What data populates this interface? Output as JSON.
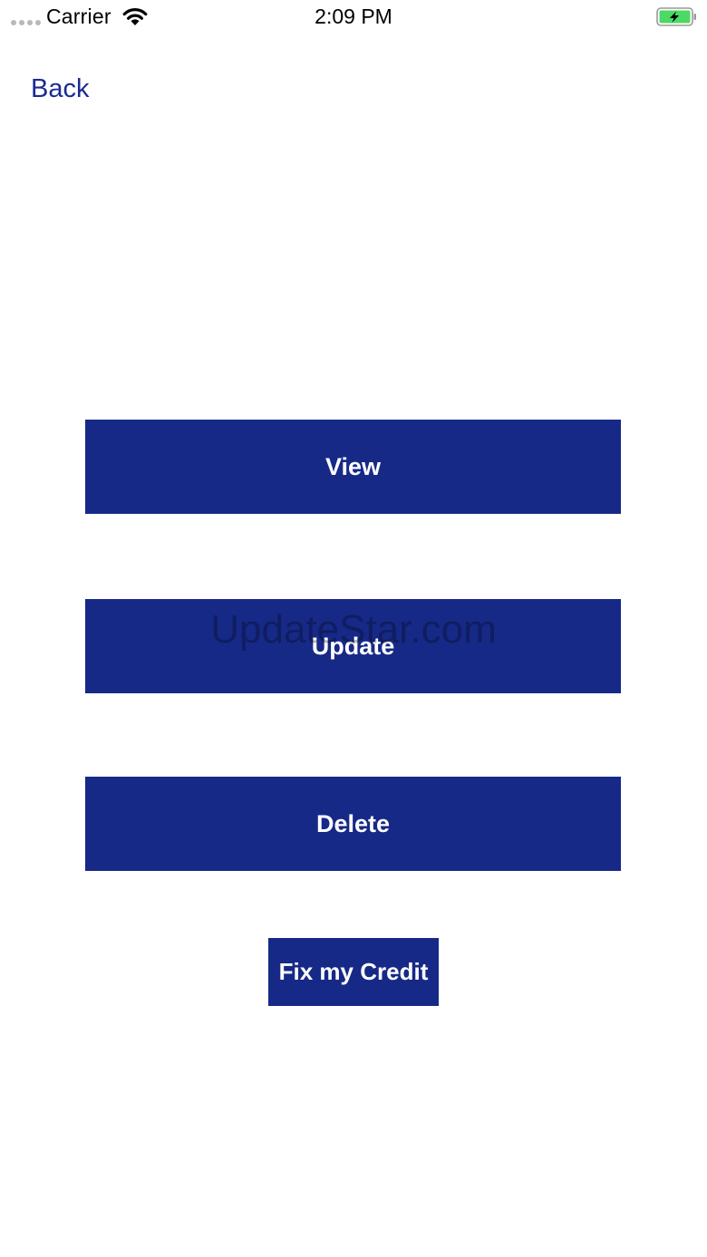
{
  "status_bar": {
    "carrier": "Carrier",
    "time": "2:09 PM",
    "icons": [
      "signal-dots-icon",
      "wifi-icon",
      "battery-charging-icon"
    ],
    "battery_color": "#4cd964"
  },
  "nav": {
    "back_label": "Back"
  },
  "buttons": {
    "view_label": "View",
    "update_label": "Update",
    "delete_label": "Delete",
    "fix_credit_label": "Fix my Credit"
  },
  "watermark": "UpdateStar.com",
  "colors": {
    "accent": "#172987",
    "link": "#1a2a96",
    "background": "#ffffff",
    "button_text": "#ffffff"
  }
}
